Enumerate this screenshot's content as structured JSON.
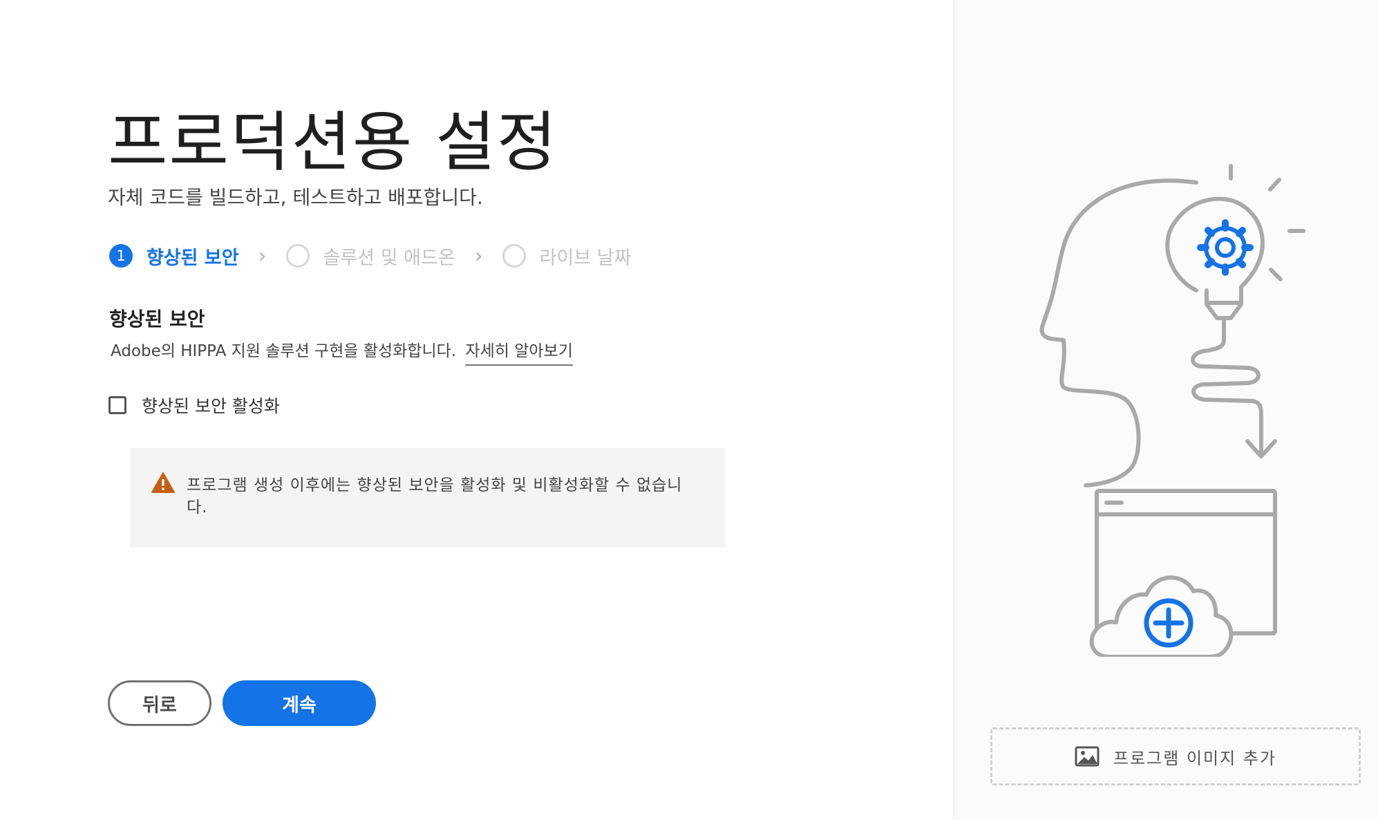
{
  "header": {
    "title": "프로덕션용 설정",
    "subtitle": "자체 코드를 빌드하고, 테스트하고 배포합니다."
  },
  "steps": [
    {
      "number": "1",
      "label": "향상된 보안",
      "state": "active"
    },
    {
      "number": "",
      "label": "솔루션 및 애드온",
      "state": "todo"
    },
    {
      "number": "",
      "label": "라이브 날짜",
      "state": "todo"
    }
  ],
  "section": {
    "heading": "향상된 보안",
    "description": "Adobe의 HIPPA 지원 솔루션 구현을 활성화합니다.",
    "learn_more": "자세히 알아보기"
  },
  "checkbox": {
    "label": "향상된 보안 활성화",
    "checked": false
  },
  "alert": {
    "icon": "warning-icon",
    "text": "프로그램 생성 이후에는 향상된 보안을 활성화 및 비활성화할 수 없습니다."
  },
  "buttons": {
    "back": "뒤로",
    "continue": "계속"
  },
  "side_panel": {
    "add_image_label": "프로그램 이미지 추가",
    "add_image_icon": "image-icon"
  },
  "colors": {
    "accent": "#1473e6",
    "warning": "#c65e14",
    "illustration_gray": "#a9a9a9"
  }
}
